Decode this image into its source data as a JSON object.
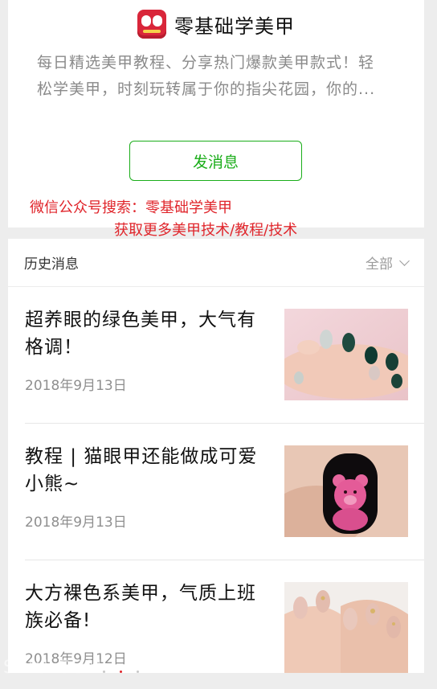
{
  "account": {
    "name": "零基础学美甲",
    "description": "每日精选美甲教程、分享热门爆款美甲款式！轻\n松学美甲，时刻玩转属于你的指尖花园，你的...",
    "message_button": "发消息"
  },
  "promo": {
    "line1": "微信公众号搜索：零基础学美甲",
    "line2": "获取更多美甲技术/教程/技术"
  },
  "history": {
    "title": "历史消息",
    "filter_label": "全部"
  },
  "articles": [
    {
      "title": "超养眼的绿色美甲，大气有格调！",
      "date": "2018年9月13日"
    },
    {
      "title": "教程 | 猫眼甲还能做成可爱小熊~",
      "date": "2018年9月13日"
    },
    {
      "title": "大方裸色系美甲，气质上班族必备!",
      "date": "2018年9月12日"
    }
  ],
  "watermark": "SIYU·COM",
  "colors": {
    "accent_green": "#1aad19",
    "promo_red": "#e0252b",
    "logo_red": "#d9263a"
  }
}
